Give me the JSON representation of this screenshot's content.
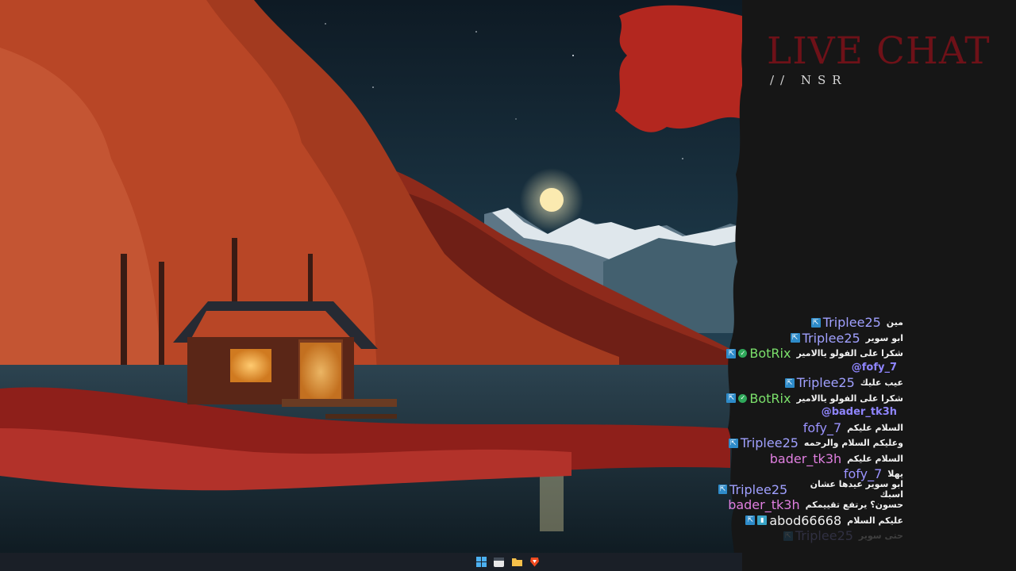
{
  "overlay": {
    "title": "LIVE CHAT",
    "subtitle": "// NSR"
  },
  "colors": {
    "title": "#6e1118",
    "mention": "#8f85ff",
    "badge": "#2e8bc9",
    "verified": "#2fa85a"
  },
  "chat": {
    "messages": [
      {
        "user": "Triplee25",
        "color": "#a0a0ff",
        "text": "مين",
        "badges": [
          "mod-icon"
        ]
      },
      {
        "user": "Triplee25",
        "color": "#a0a0ff",
        "text": "ابو سوير",
        "badges": [
          "mod-icon"
        ]
      },
      {
        "user": "BotRix",
        "color": "#7be06b",
        "text": "شكرا على الفولو ياالامير",
        "badges": [
          "mod-icon",
          "verified-icon"
        ],
        "mention": "@fofy_7"
      },
      {
        "user": "Triplee25",
        "color": "#a0a0ff",
        "text": "عيب عليك",
        "badges": [
          "mod-icon"
        ]
      },
      {
        "user": "BotRix",
        "color": "#7be06b",
        "text": "شكرا على الفولو ياالامير",
        "badges": [
          "mod-icon",
          "verified-icon"
        ],
        "mention": "@bader_tk3h"
      },
      {
        "user": "fofy_7",
        "color": "#9b93ff",
        "text": "السلام عليكم",
        "badges": []
      },
      {
        "user": "Triplee25",
        "color": "#a0a0ff",
        "text": "وعليكم السلام والرحمه",
        "badges": [
          "mod-icon"
        ]
      },
      {
        "user": "bader_tk3h",
        "color": "#e07fe0",
        "text": "السلام عليكم",
        "badges": []
      },
      {
        "user": "fofy_7",
        "color": "#9b93ff",
        "text": "يهلا",
        "badges": []
      },
      {
        "user": "Triplee25",
        "color": "#a0a0ff",
        "text": "ابو سوير عيدها عشان اسبك",
        "badges": [
          "mod-icon"
        ]
      },
      {
        "user": "bader_tk3h",
        "color": "#e07fe0",
        "text": "حسون؟ يرتفع تقييمكم",
        "badges": []
      },
      {
        "user": "abod66668",
        "color": "#f2f2f2",
        "text": "عليكم السلام",
        "badges": [
          "mod-icon",
          "extra-icon"
        ]
      },
      {
        "user": "Triplee25",
        "color": "#a0a0ff",
        "text": "حتى سوير",
        "badges": [
          "mod-icon"
        ],
        "faded": true
      }
    ]
  },
  "taskbar": {
    "icons": [
      "windows-start-icon",
      "calendar-icon",
      "folder-icon",
      "brave-browser-icon"
    ]
  }
}
